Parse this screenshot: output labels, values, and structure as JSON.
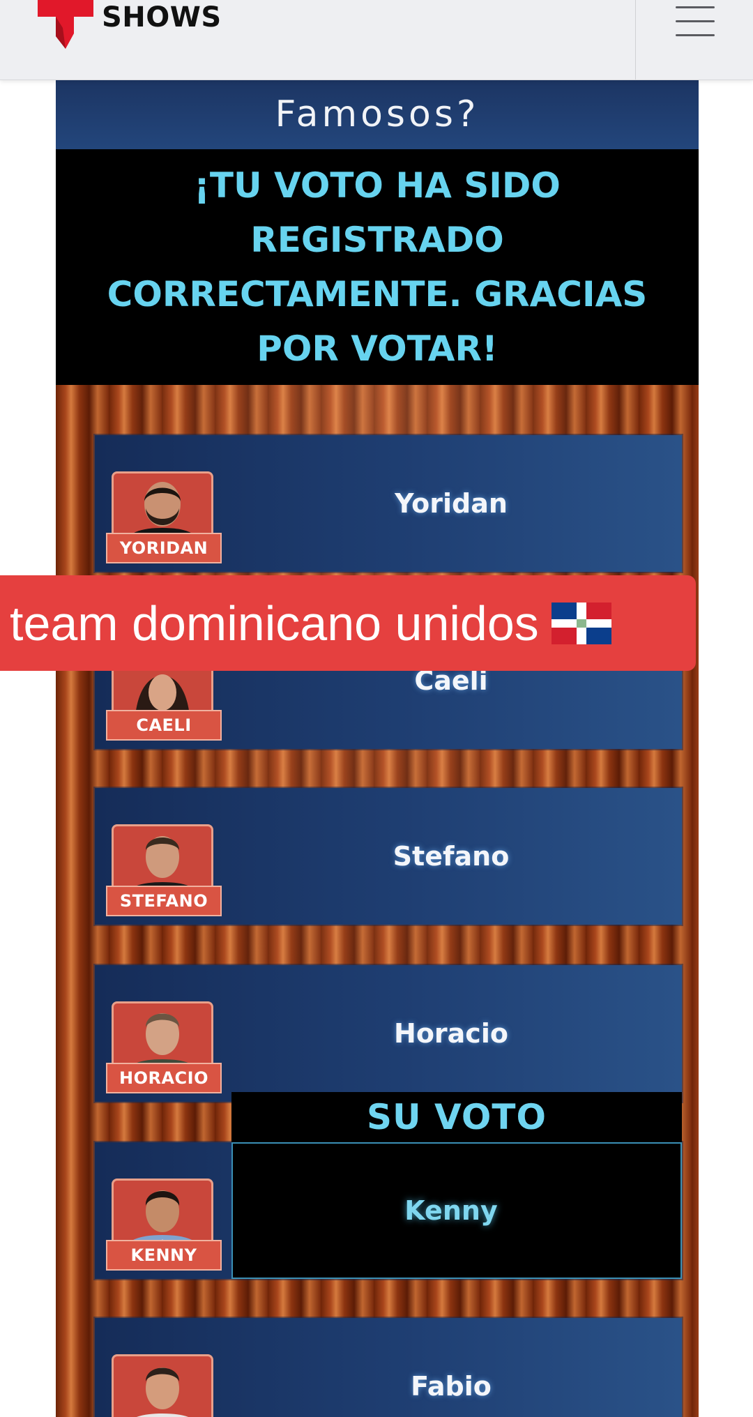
{
  "header": {
    "logo_label": "SHOWS",
    "logo_icon": "telemundo-t-icon",
    "menu_icon": "hamburger-icon",
    "brand_color": "#e1182a"
  },
  "panel": {
    "title": "Famosos?",
    "confirmation": "¡TU VOTO HA SIDO REGISTRADO CORRECTAMENTE. GRACIAS POR VOTAR!",
    "vote_label": "SU VOTO",
    "accent_color": "#67d3ef"
  },
  "contestants": [
    {
      "tag": "YORIDAN",
      "name": "Yoridan"
    },
    {
      "tag": "CAELI",
      "name": "Caeli"
    },
    {
      "tag": "STEFANO",
      "name": "Stefano"
    },
    {
      "tag": "HORACIO",
      "name": "Horacio"
    },
    {
      "tag": "KENNY",
      "name": "Kenny"
    },
    {
      "tag": "",
      "name": "Fabio"
    }
  ],
  "overlay": {
    "caption": "team dominicano unidos",
    "flag_icon": "dominican-republic-flag-icon",
    "background_color": "#e5403f"
  }
}
